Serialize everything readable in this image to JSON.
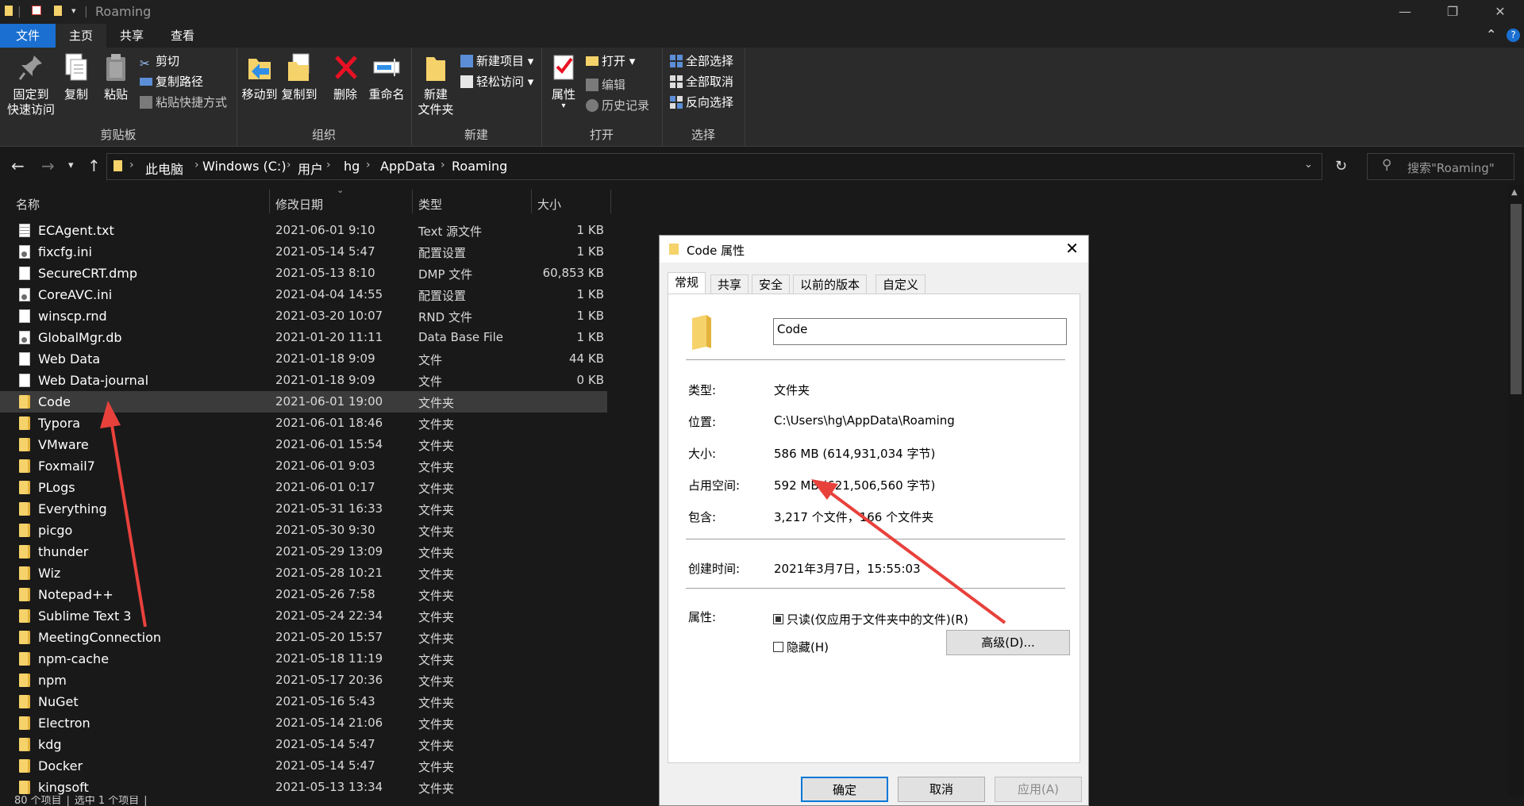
{
  "window": {
    "title": "Roaming"
  },
  "ribbon_tabs": [
    "文件",
    "主页",
    "共享",
    "查看"
  ],
  "ribbon": {
    "clipboard": {
      "pin": "固定到\n快速访问",
      "copy": "复制",
      "paste": "粘贴",
      "cut": "剪切",
      "copy_path": "复制路径",
      "paste_shortcut": "粘贴快捷方式",
      "label": "剪贴板"
    },
    "organize": {
      "move_to": "移动到",
      "copy_to": "复制到",
      "delete": "删除",
      "rename": "重命名",
      "label": "组织"
    },
    "new": {
      "new_folder": "新建\n文件夹",
      "new_item": "新建项目",
      "easy_access": "轻松访问",
      "label": "新建"
    },
    "open": {
      "properties": "属性",
      "open": "打开",
      "edit": "编辑",
      "history": "历史记录",
      "label": "打开"
    },
    "select": {
      "select_all": "全部选择",
      "select_none": "全部取消",
      "invert": "反向选择",
      "label": "选择"
    }
  },
  "breadcrumb": [
    "此电脑",
    "Windows (C:)",
    "用户",
    "hg",
    "AppData",
    "Roaming"
  ],
  "search": {
    "placeholder": "搜索\"Roaming\""
  },
  "columns": {
    "name": "名称",
    "date": "修改日期",
    "type": "类型",
    "size": "大小"
  },
  "files": [
    {
      "name": "ECAgent.txt",
      "date": "2021-06-01 9:10",
      "type": "Text 源文件",
      "size": "1 KB",
      "icon": "txt"
    },
    {
      "name": "fixcfg.ini",
      "date": "2021-05-14 5:47",
      "type": "配置设置",
      "size": "1 KB",
      "icon": "cfg"
    },
    {
      "name": "SecureCRT.dmp",
      "date": "2021-05-13 8:10",
      "type": "DMP 文件",
      "size": "60,853 KB",
      "icon": "file"
    },
    {
      "name": "CoreAVC.ini",
      "date": "2021-04-04 14:55",
      "type": "配置设置",
      "size": "1 KB",
      "icon": "cfg"
    },
    {
      "name": "winscp.rnd",
      "date": "2021-03-20 10:07",
      "type": "RND 文件",
      "size": "1 KB",
      "icon": "file"
    },
    {
      "name": "GlobalMgr.db",
      "date": "2021-01-20 11:11",
      "type": "Data Base File",
      "size": "1 KB",
      "icon": "cfg"
    },
    {
      "name": "Web Data",
      "date": "2021-01-18 9:09",
      "type": "文件",
      "size": "44 KB",
      "icon": "file"
    },
    {
      "name": "Web Data-journal",
      "date": "2021-01-18 9:09",
      "type": "文件",
      "size": "0 KB",
      "icon": "file"
    },
    {
      "name": "Code",
      "date": "2021-06-01 19:00",
      "type": "文件夹",
      "size": "",
      "icon": "folder",
      "selected": true
    },
    {
      "name": "Typora",
      "date": "2021-06-01 18:46",
      "type": "文件夹",
      "size": "",
      "icon": "folder"
    },
    {
      "name": "VMware",
      "date": "2021-06-01 15:54",
      "type": "文件夹",
      "size": "",
      "icon": "folder"
    },
    {
      "name": "Foxmail7",
      "date": "2021-06-01 9:03",
      "type": "文件夹",
      "size": "",
      "icon": "folder"
    },
    {
      "name": "PLogs",
      "date": "2021-06-01 0:17",
      "type": "文件夹",
      "size": "",
      "icon": "folder"
    },
    {
      "name": "Everything",
      "date": "2021-05-31 16:33",
      "type": "文件夹",
      "size": "",
      "icon": "folder"
    },
    {
      "name": "picgo",
      "date": "2021-05-30 9:30",
      "type": "文件夹",
      "size": "",
      "icon": "folder"
    },
    {
      "name": "thunder",
      "date": "2021-05-29 13:09",
      "type": "文件夹",
      "size": "",
      "icon": "folder"
    },
    {
      "name": "Wiz",
      "date": "2021-05-28 10:21",
      "type": "文件夹",
      "size": "",
      "icon": "folder"
    },
    {
      "name": "Notepad++",
      "date": "2021-05-26 7:58",
      "type": "文件夹",
      "size": "",
      "icon": "folder"
    },
    {
      "name": "Sublime Text 3",
      "date": "2021-05-24 22:34",
      "type": "文件夹",
      "size": "",
      "icon": "folder"
    },
    {
      "name": "MeetingConnection",
      "date": "2021-05-20 15:57",
      "type": "文件夹",
      "size": "",
      "icon": "folder"
    },
    {
      "name": "npm-cache",
      "date": "2021-05-18 11:19",
      "type": "文件夹",
      "size": "",
      "icon": "folder"
    },
    {
      "name": "npm",
      "date": "2021-05-17 20:36",
      "type": "文件夹",
      "size": "",
      "icon": "folder"
    },
    {
      "name": "NuGet",
      "date": "2021-05-16 5:43",
      "type": "文件夹",
      "size": "",
      "icon": "folder"
    },
    {
      "name": "Electron",
      "date": "2021-05-14 21:06",
      "type": "文件夹",
      "size": "",
      "icon": "folder"
    },
    {
      "name": "kdg",
      "date": "2021-05-14 5:47",
      "type": "文件夹",
      "size": "",
      "icon": "folder"
    },
    {
      "name": "Docker",
      "date": "2021-05-14 5:47",
      "type": "文件夹",
      "size": "",
      "icon": "folder"
    },
    {
      "name": "kingsoft",
      "date": "2021-05-13 13:34",
      "type": "文件夹",
      "size": "",
      "icon": "folder"
    }
  ],
  "status": "80 个项目 │ 选中 1 个项目 │",
  "dialog": {
    "title": "Code 属性",
    "tabs": [
      "常规",
      "共享",
      "安全",
      "以前的版本",
      "自定义"
    ],
    "name_value": "Code",
    "type_label": "类型:",
    "type_value": "文件夹",
    "location_label": "位置:",
    "location_value": "C:\\Users\\hg\\AppData\\Roaming",
    "size_label": "大小:",
    "size_value": "586 MB (614,931,034 字节)",
    "disk_label": "占用空间:",
    "disk_value": "592 MB (621,506,560 字节)",
    "contains_label": "包含:",
    "contains_value": "3,217 个文件，166 个文件夹",
    "created_label": "创建时间:",
    "created_value": "2021年3月7日，15:55:03",
    "attr_label": "属性:",
    "readonly_label": "只读(仅应用于文件夹中的文件)(R)",
    "hidden_label": "隐藏(H)",
    "advanced_button": "高级(D)...",
    "ok": "确定",
    "cancel": "取消",
    "apply": "应用(A)"
  },
  "colors": {
    "accent": "#1a6fd0",
    "folder": "#f6d26a",
    "arrow": "#e8413c",
    "primary_border": "#0078d7"
  }
}
